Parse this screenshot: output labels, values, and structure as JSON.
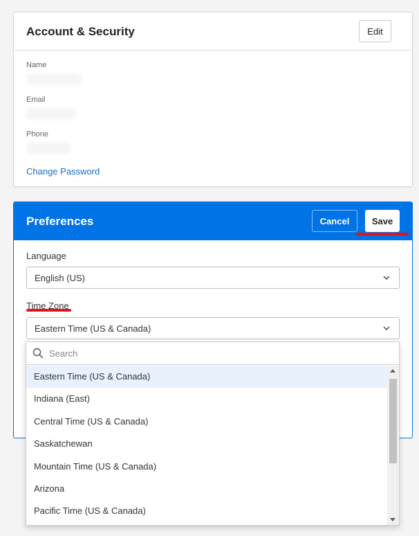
{
  "account": {
    "title": "Account & Security",
    "edit_label": "Edit",
    "fields": [
      {
        "label": "Name"
      },
      {
        "label": "Email"
      },
      {
        "label": "Phone"
      }
    ],
    "change_password_label": "Change Password"
  },
  "preferences": {
    "title": "Preferences",
    "cancel_label": "Cancel",
    "save_label": "Save",
    "language_label": "Language",
    "language_value": "English (US)",
    "timezone_label": "Time Zone",
    "timezone_value": "Eastern Time (US & Canada)"
  },
  "dropdown": {
    "search_placeholder": "Search",
    "options": [
      "Eastern Time (US & Canada)",
      "Indiana (East)",
      "Central Time (US & Canada)",
      "Saskatchewan",
      "Mountain Time (US & Canada)",
      "Arizona",
      "Pacific Time (US & Canada)"
    ],
    "active_index": 0
  },
  "colors": {
    "accent": "#0073e6",
    "link": "#1a6fc9",
    "highlight": "#e0141e",
    "active_option": "#e8f2fc"
  },
  "icons": {
    "search": "search-icon",
    "chevron": "chevron-down-icon"
  }
}
